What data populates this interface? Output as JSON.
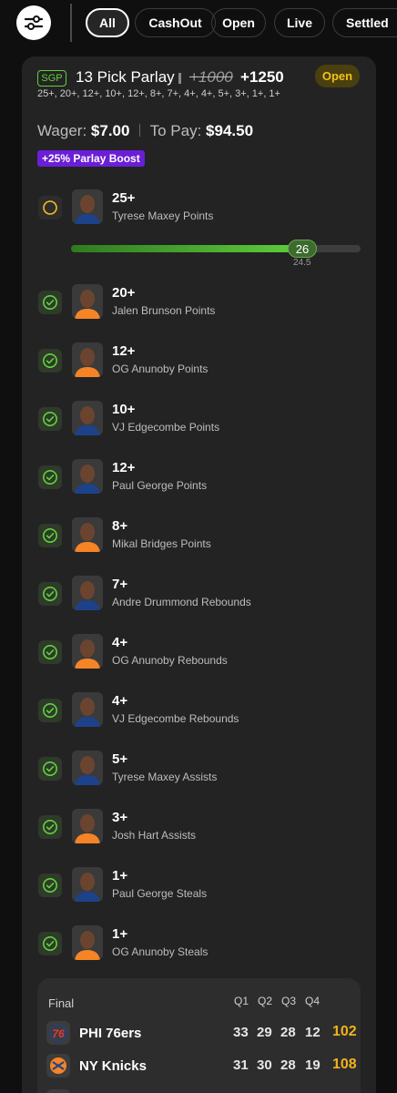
{
  "header": {
    "filter_icon": "sliders-icon",
    "tabs": [
      {
        "label": "All",
        "active": true
      },
      {
        "label": "CashOut",
        "active": false
      },
      {
        "label": "Open",
        "active": false
      },
      {
        "label": "Live",
        "active": false
      },
      {
        "label": "Settled",
        "active": false
      }
    ]
  },
  "bet": {
    "badge": "SGP",
    "title": "13 Pick Parlay",
    "original_odds": "+1000",
    "odds": "+1250",
    "status": "Open",
    "legs_summary": "25+, 20+, 12+, 10+, 12+, 8+, 7+, 4+, 4+, 5+, 3+, 1+, 1+",
    "wager_label": "Wager:",
    "wager": "$7.00",
    "to_pay_label": "To Pay:",
    "to_pay": "$94.50",
    "boost": "+25% Parlay Boost"
  },
  "legs": [
    {
      "line": "25+",
      "desc": "Tyrese Maxey Points",
      "status": "pending",
      "jersey": "#1d428a"
    },
    {
      "line": "20+",
      "desc": "Jalen Brunson Points",
      "status": "won",
      "jersey": "#f58426"
    },
    {
      "line": "12+",
      "desc": "OG Anunoby Points",
      "status": "won",
      "jersey": "#f58426"
    },
    {
      "line": "10+",
      "desc": "VJ Edgecombe Points",
      "status": "won",
      "jersey": "#1d428a"
    },
    {
      "line": "12+",
      "desc": "Paul George Points",
      "status": "won",
      "jersey": "#1d428a"
    },
    {
      "line": "8+",
      "desc": "Mikal Bridges Points",
      "status": "won",
      "jersey": "#f58426"
    },
    {
      "line": "7+",
      "desc": "Andre Drummond Rebounds",
      "status": "won",
      "jersey": "#1d428a"
    },
    {
      "line": "4+",
      "desc": "OG Anunoby Rebounds",
      "status": "won",
      "jersey": "#f58426"
    },
    {
      "line": "4+",
      "desc": "VJ Edgecombe Rebounds",
      "status": "won",
      "jersey": "#1d428a"
    },
    {
      "line": "5+",
      "desc": "Tyrese Maxey Assists",
      "status": "won",
      "jersey": "#1d428a"
    },
    {
      "line": "3+",
      "desc": "Josh Hart Assists",
      "status": "won",
      "jersey": "#f58426"
    },
    {
      "line": "1+",
      "desc": "Paul George Steals",
      "status": "won",
      "jersey": "#1d428a"
    },
    {
      "line": "1+",
      "desc": "OG Anunoby Steals",
      "status": "won",
      "jersey": "#f58426"
    }
  ],
  "progress": {
    "current": "26",
    "target": "24.5",
    "fraction": 0.82
  },
  "scoreboard": {
    "status": "Final",
    "quarters": [
      "Q1",
      "Q2",
      "Q3",
      "Q4"
    ],
    "teams": [
      {
        "name": "PHI 76ers",
        "scores": [
          "33",
          "29",
          "28",
          "12"
        ],
        "total": "102",
        "logo": "76ers-logo-icon"
      },
      {
        "name": "NY Knicks",
        "scores": [
          "31",
          "30",
          "28",
          "19"
        ],
        "total": "108",
        "logo": "knicks-logo-icon"
      }
    ]
  },
  "colors": {
    "win_green": "#5fd23c",
    "pending_yellow": "#f2c11b",
    "boost_purple": "#6a1fd6",
    "total_gold": "#f2b31b"
  }
}
